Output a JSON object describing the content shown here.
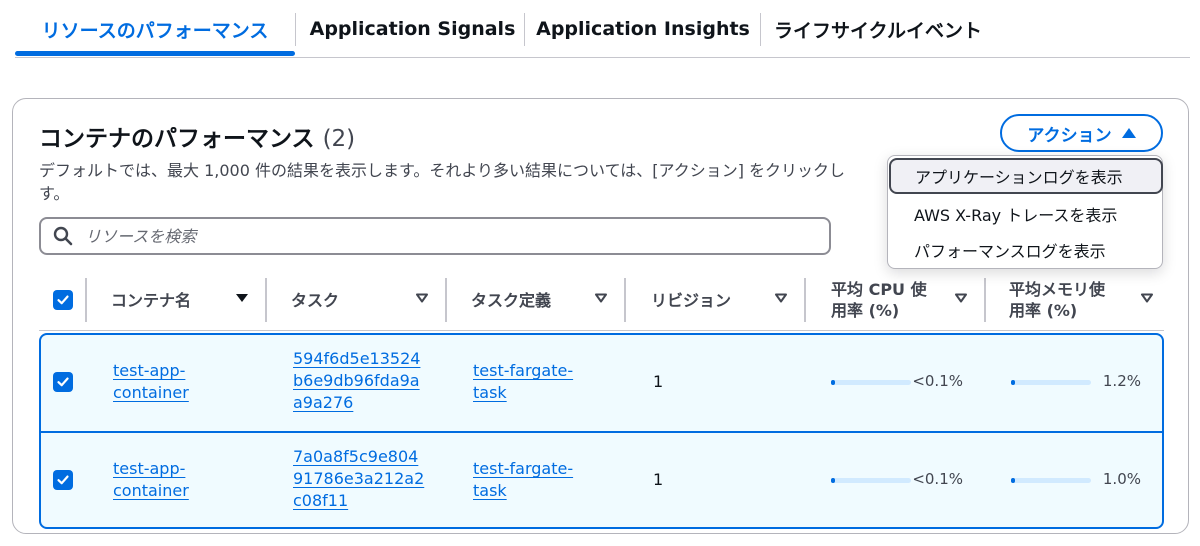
{
  "tabs": [
    {
      "label": "リソースのパフォーマンス",
      "active": true
    },
    {
      "label": "Application Signals"
    },
    {
      "label": "Application Insights"
    },
    {
      "label": "ライフサイクルイベント"
    }
  ],
  "panel": {
    "title": "コンテナのパフォーマンス",
    "count": "(2)",
    "description": "デフォルトでは、最大 1,000 件の結果を表示します。それより多い結果については、[アクション] をクリックし",
    "description_line2": "す。"
  },
  "actions": {
    "button_label": "アクション",
    "menu": [
      "アプリケーションログを表示",
      "AWS X-Ray トレースを表示",
      "パフォーマンスログを表示"
    ]
  },
  "search": {
    "placeholder": "リソースを検索",
    "value": ""
  },
  "table": {
    "columns": [
      {
        "label": "コンテナ名",
        "sort": "sorted-desc"
      },
      {
        "label": "タスク",
        "sort": "unsorted"
      },
      {
        "label": "タスク定義",
        "sort": "unsorted"
      },
      {
        "label": "リビジョン",
        "sort": "unsorted"
      },
      {
        "label_line1": "平均 CPU 使",
        "label_line2": "用率 (%)",
        "sort": "unsorted"
      },
      {
        "label_line1": "平均メモリ使",
        "label_line2": "用率 (%)",
        "sort": "unsorted"
      }
    ],
    "rows": [
      {
        "selected": true,
        "container_line1": "test-app-",
        "container_line2": "container",
        "task_line1": "594f6d5e13524",
        "task_line2": "b6e9db96fda9a",
        "task_line3": "a9a276",
        "taskdef_line1": "test-fargate-",
        "taskdef_line2": "task",
        "revision": "1",
        "cpu_text": "<0.1%",
        "cpu_value": 0.1,
        "mem_text": "1.2%",
        "mem_value": 1.2
      },
      {
        "selected": true,
        "container_line1": "test-app-",
        "container_line2": "container",
        "task_line1": "7a0a8f5c9e804",
        "task_line2": "91786e3a212a2",
        "task_line3": "c08f11",
        "taskdef_line1": "test-fargate-",
        "taskdef_line2": "task",
        "revision": "1",
        "cpu_text": "<0.1%",
        "cpu_value": 0.1,
        "mem_text": "1.0%",
        "mem_value": 1.0
      }
    ]
  },
  "colors": {
    "accent": "#006ce0",
    "selected_row_bg": "#f0fbff",
    "bar_track": "#d1eaff"
  }
}
